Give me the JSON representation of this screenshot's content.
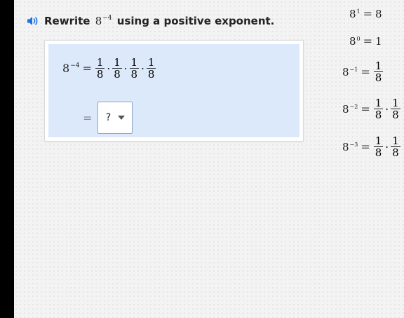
{
  "prompt": {
    "pre": "Rewrite",
    "math_base": "8",
    "math_exp": "−4",
    "post": "using a positive exponent."
  },
  "work": {
    "lhs_base": "8",
    "lhs_exp": "−4",
    "eq": "=",
    "dot": "·",
    "fractions": [
      {
        "num": "1",
        "den": "8"
      },
      {
        "num": "1",
        "den": "8"
      },
      {
        "num": "1",
        "den": "8"
      },
      {
        "num": "1",
        "den": "8"
      }
    ],
    "answer_eq": "=",
    "dropdown_value": "?"
  },
  "sidebar": {
    "rows": [
      {
        "base": "8",
        "exp": "1",
        "rhs": "8"
      },
      {
        "base": "8",
        "exp": "0",
        "rhs": "1"
      },
      {
        "base": "8",
        "exp": "−1",
        "num": "1",
        "den": "8"
      },
      {
        "base": "8",
        "exp": "−2",
        "num": "1",
        "den": "8",
        "num2": "1",
        "den2": "8"
      },
      {
        "base": "8",
        "exp": "−3",
        "num": "1",
        "den": "8",
        "num2": "1",
        "den2": "8"
      }
    ]
  },
  "colors": {
    "panel_bg": "#dce9fb",
    "accent": "#1a73e8",
    "left_bar": "#000000",
    "background": "#f3f3f3"
  }
}
